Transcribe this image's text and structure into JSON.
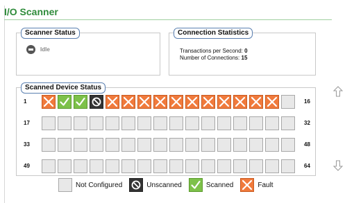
{
  "page": {
    "title": "I/O Scanner"
  },
  "scanner_status": {
    "legend": "Scanner Status",
    "state": "Idle",
    "icon": "idle-icon"
  },
  "connection_statistics": {
    "legend": "Connection Statistics",
    "tps_label": "Transactions per Second: ",
    "tps_value": "0",
    "connections_label": "Number of Connections: ",
    "connections_value": "15"
  },
  "scanned_device_status": {
    "legend": "Scanned Device Status",
    "rows": [
      {
        "start": "1",
        "end": "16",
        "cells": [
          "fault",
          "scanned",
          "scanned",
          "unscanned",
          "fault",
          "fault",
          "fault",
          "fault",
          "fault",
          "fault",
          "fault",
          "fault",
          "fault",
          "fault",
          "fault",
          "not_configured"
        ]
      },
      {
        "start": "17",
        "end": "32",
        "cells": [
          "not_configured",
          "not_configured",
          "not_configured",
          "not_configured",
          "not_configured",
          "not_configured",
          "not_configured",
          "not_configured",
          "not_configured",
          "not_configured",
          "not_configured",
          "not_configured",
          "not_configured",
          "not_configured",
          "not_configured",
          "not_configured"
        ]
      },
      {
        "start": "33",
        "end": "48",
        "cells": [
          "not_configured",
          "not_configured",
          "not_configured",
          "not_configured",
          "not_configured",
          "not_configured",
          "not_configured",
          "not_configured",
          "not_configured",
          "not_configured",
          "not_configured",
          "not_configured",
          "not_configured",
          "not_configured",
          "not_configured",
          "not_configured"
        ]
      },
      {
        "start": "49",
        "end": "64",
        "cells": [
          "not_configured",
          "not_configured",
          "not_configured",
          "not_configured",
          "not_configured",
          "not_configured",
          "not_configured",
          "not_configured",
          "not_configured",
          "not_configured",
          "not_configured",
          "not_configured",
          "not_configured",
          "not_configured",
          "not_configured",
          "not_configured"
        ]
      }
    ]
  },
  "legend": {
    "not_configured": "Not Configured",
    "unscanned": "Unscanned",
    "scanned": "Scanned",
    "fault": "Fault"
  },
  "scroll": {
    "up_icon": "arrow-up-icon",
    "down_icon": "arrow-down-icon"
  },
  "colors": {
    "title": "#2e8b3a",
    "fault": "#f07a3c",
    "scanned": "#7dc14a",
    "unscanned": "#333333",
    "not_configured": "#e8e8e8"
  }
}
